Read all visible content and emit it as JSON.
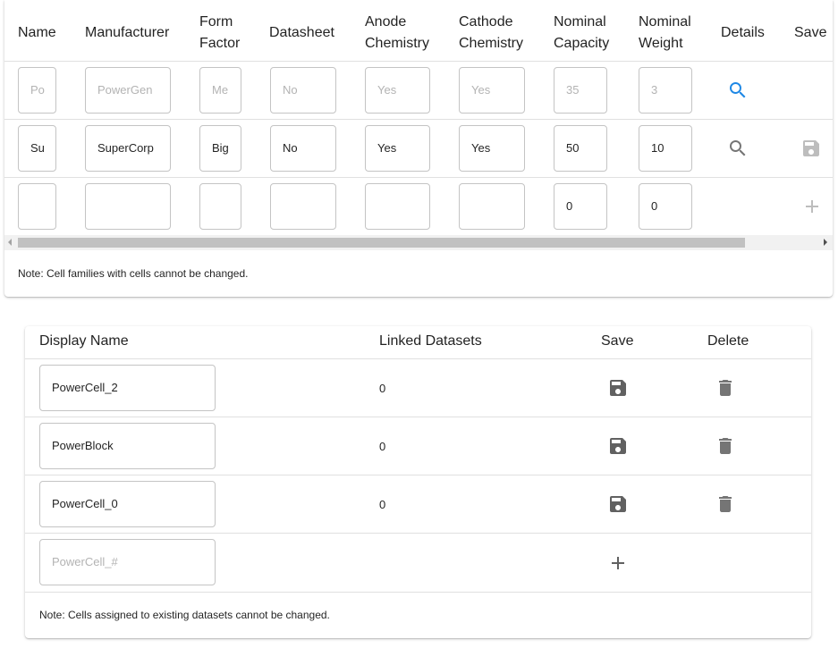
{
  "cell_families": {
    "headers": {
      "name": "Name",
      "manufacturer": "Manufacturer",
      "form_factor_1": "Form",
      "form_factor_2": "Factor",
      "datasheet": "Datasheet",
      "anode_1": "Anode",
      "anode_2": "Chemistry",
      "cathode_1": "Cathode",
      "cathode_2": "Chemistry",
      "capacity_1": "Nominal",
      "capacity_2": "Capacity",
      "weight_1": "Nominal",
      "weight_2": "Weight",
      "details": "Details",
      "save": "Save"
    },
    "rows": [
      {
        "name": "Po",
        "manufacturer": "PowerGen",
        "form_factor": "Me",
        "datasheet": "No",
        "anode": "Yes",
        "cathode": "Yes",
        "capacity": "35",
        "weight": "3"
      },
      {
        "name": "Su",
        "manufacturer": "SuperCorp",
        "form_factor": "Big",
        "datasheet": "No",
        "anode": "Yes",
        "cathode": "Yes",
        "capacity": "50",
        "weight": "10"
      },
      {
        "name": "",
        "manufacturer": "",
        "form_factor": "",
        "datasheet": "",
        "anode": "",
        "cathode": "",
        "capacity": "0",
        "weight": "0"
      }
    ],
    "note": "Note: Cell families with cells cannot be changed.",
    "colors": {
      "details_active": "#1e88e5",
      "icon_grey": "#757575",
      "icon_disabled": "#bdbdbd"
    }
  },
  "cells": {
    "headers": {
      "display_name": "Display Name",
      "linked_datasets": "Linked Datasets",
      "save": "Save",
      "delete": "Delete"
    },
    "rows": [
      {
        "display_name": "PowerCell_2",
        "linked": "0"
      },
      {
        "display_name": "PowerBlock",
        "linked": "0"
      },
      {
        "display_name": "PowerCell_0",
        "linked": "0"
      }
    ],
    "new_row_placeholder": "PowerCell_#",
    "note": "Note: Cells assigned to existing datasets cannot be changed."
  }
}
